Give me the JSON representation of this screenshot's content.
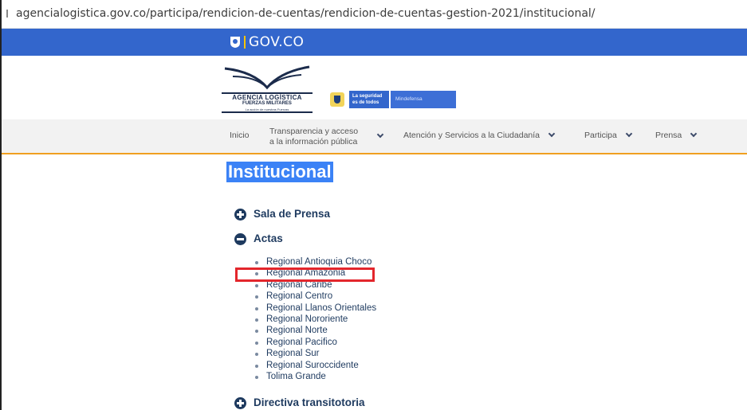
{
  "browser": {
    "url": "agencialogistica.gov.co/participa/rendicion-de-cuentas/rendicion-de-cuentas-gestion-2021/institucional/"
  },
  "govco_bar": {
    "brand": "GOV.CO",
    "color": "#3366cc"
  },
  "header": {
    "logo_title": "AGENCIA LOGÍSTICA",
    "logo_subtitle": "FUERZAS MILITARES",
    "logo_tagline": "La acción de nuestras Fuerzas",
    "mindef_lema": "La seguridad es de todos",
    "mindef_name": "Mindefensa"
  },
  "nav": {
    "inicio": "Inicio",
    "transparencia_line1": "Transparencia y acceso",
    "transparencia_line2": "a la información pública",
    "atencion": "Atención y Servicios a la Ciudadanía",
    "participa": "Participa",
    "prensa": "Prensa",
    "accent_color": "#f0a020"
  },
  "main": {
    "title": "Institucional",
    "sections": {
      "sala_prensa": "Sala de Prensa",
      "actas": "Actas",
      "directiva": "Directiva transitotoria"
    },
    "actas_items": [
      "Regional Antioquia Choco",
      "Regional Amazonia",
      "Regional Caribe",
      "Regional Centro",
      "Regional Llanos Orientales",
      "Regional Nororiente",
      "Regional Norte",
      "Regional Pacifico",
      "Regional Sur",
      "Regional Suroccidente",
      "Tolima Grande"
    ],
    "highlight_color": "#e3262c"
  }
}
